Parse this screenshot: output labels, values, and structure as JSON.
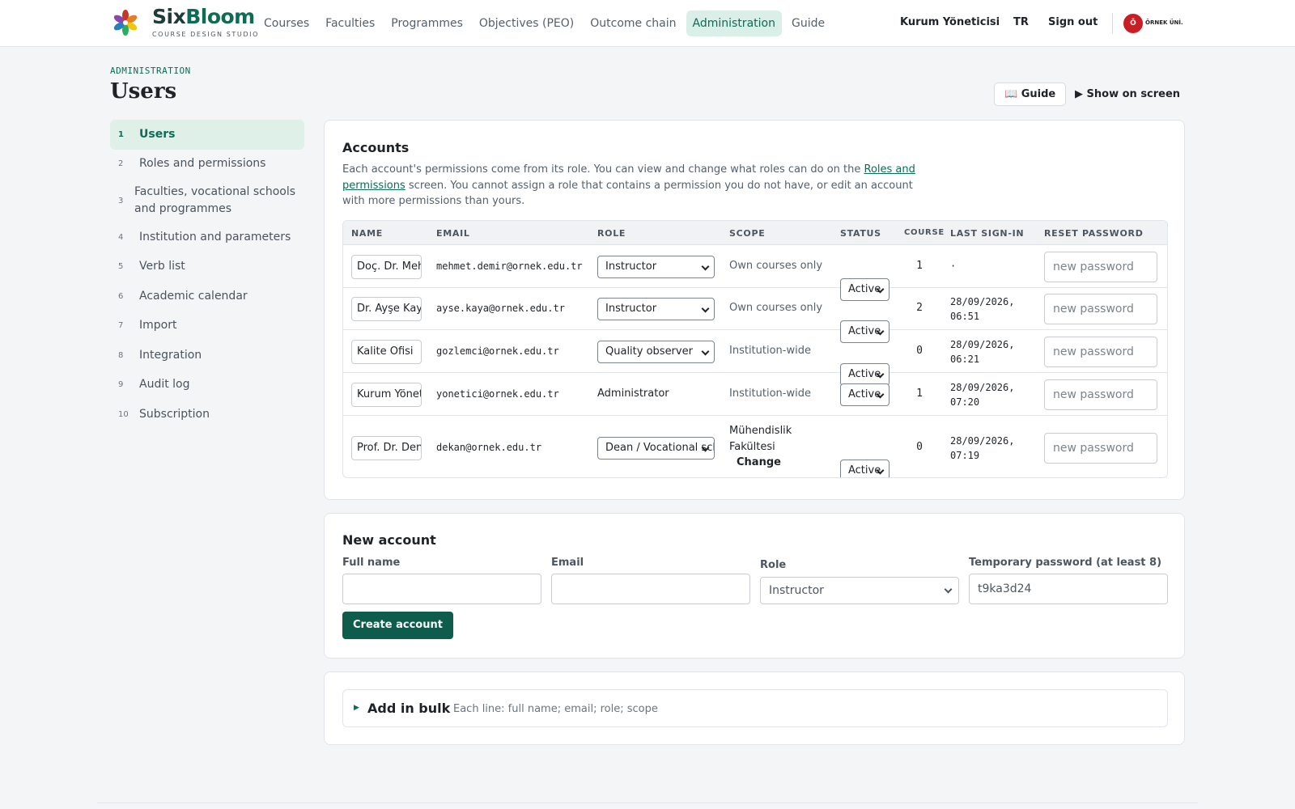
{
  "brand": {
    "name_part1": "Six",
    "name_part2": "Bloom",
    "tagline": "COURSE DESIGN STUDIO"
  },
  "nav": [
    {
      "label": "Courses",
      "active": false
    },
    {
      "label": "Faculties",
      "active": false
    },
    {
      "label": "Programmes",
      "active": false
    },
    {
      "label": "Objectives (PEO)",
      "active": false
    },
    {
      "label": "Outcome chain",
      "active": false
    },
    {
      "label": "Administration",
      "active": true
    },
    {
      "label": "Guide",
      "active": false
    }
  ],
  "header": {
    "user": "Kurum Yöneticisi",
    "language": "TR",
    "sign_out": "Sign out",
    "institution_initial": "Ö",
    "institution_name": "ÖRNEK ÜNİ."
  },
  "page": {
    "eyebrow": "ADMINISTRATION",
    "title": "Users",
    "guide_button": "📖 Guide",
    "show_button": "▶ Show on screen"
  },
  "sidebar": [
    {
      "num": "1",
      "label": "Users",
      "active": true
    },
    {
      "num": "2",
      "label": "Roles and permissions"
    },
    {
      "num": "3",
      "label": "Faculties, vocational schools and programmes"
    },
    {
      "num": "4",
      "label": "Institution and parameters"
    },
    {
      "num": "5",
      "label": "Verb list"
    },
    {
      "num": "6",
      "label": "Academic calendar"
    },
    {
      "num": "7",
      "label": "Import"
    },
    {
      "num": "8",
      "label": "Integration"
    },
    {
      "num": "9",
      "label": "Audit log"
    },
    {
      "num": "10",
      "label": "Subscription"
    }
  ],
  "accounts": {
    "title": "Accounts",
    "description_before": "Each account's permissions come from its role. You can view and change what roles can do on the ",
    "description_link": "Roles and permissions",
    "description_after": " screen. You cannot assign a role that contains a permission you do not have, or edit an account with more permissions than yours.",
    "columns": [
      "NAME",
      "EMAIL",
      "ROLE",
      "SCOPE",
      "STATUS",
      "COURSE",
      "LAST SIGN-IN",
      "RESET PASSWORD"
    ],
    "password_placeholder": "new password",
    "rows": [
      {
        "name": "Doç. Dr. Mehmet Demir",
        "email": "mehmet.demir@ornek.edu.tr",
        "role": "Instructor",
        "role_editable": true,
        "scope_line1": "Own courses only",
        "scope_line2": "",
        "status": "Active",
        "courses": "1",
        "last_line1": "·",
        "last_line2": ""
      },
      {
        "name": "Dr. Ayşe Kaya",
        "email": "ayse.kaya@ornek.edu.tr",
        "role": "Instructor",
        "role_editable": true,
        "scope_line1": "Own courses only",
        "scope_line2": "",
        "status": "Active",
        "courses": "2",
        "last_line1": "28/09/2026,",
        "last_line2": "06:51"
      },
      {
        "name": "Kalite Ofisi",
        "email": "gozlemci@ornek.edu.tr",
        "role": "Quality observer",
        "role_editable": true,
        "scope_line1": "Institution-wide",
        "scope_line2": "",
        "status": "Active",
        "courses": "0",
        "last_line1": "28/09/2026,",
        "last_line2": "06:21"
      },
      {
        "name": "Kurum Yöneticisi",
        "email": "yonetici@ornek.edu.tr",
        "role": "Administrator",
        "role_editable": false,
        "scope_line1": "Institution-wide",
        "scope_line2": "",
        "status": "Active",
        "courses": "1",
        "last_line1": "28/09/2026,",
        "last_line2": "07:20"
      },
      {
        "name": "Prof. Dr. Deniz",
        "email": "dekan@ornek.edu.tr",
        "role": "Dean / Vocational school director",
        "role_editable": true,
        "scope_line1": "Mühendislik",
        "scope_line2": "Fakültesi",
        "scope_change": "Change",
        "status": "Active",
        "courses": "0",
        "last_line1": "28/09/2026,",
        "last_line2": "07:19"
      }
    ]
  },
  "new_account": {
    "title": "New account",
    "full_name_label": "Full name",
    "email_label": "Email",
    "role_label": "Role",
    "role_value": "Instructor",
    "password_label": "Temporary password (at least 8)",
    "password_value": "t9ka3d24",
    "create_button": "Create account"
  },
  "bulk": {
    "title": "Add in bulk",
    "hint": "Each line: full name; email; role; scope"
  },
  "colors": {
    "accent": "#0e6b55",
    "accent_bg": "#d9efe7",
    "primary_button": "#0e5c4c",
    "institution_badge": "#c81e24"
  }
}
